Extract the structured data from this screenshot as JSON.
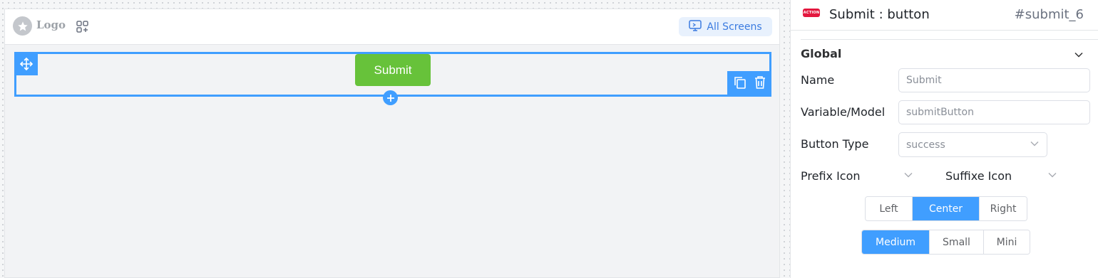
{
  "canvas": {
    "logo_text": "Logo",
    "screens_label": "All Screens",
    "submit_label": "Submit",
    "icons": [
      "star-icon",
      "add-widget-icon",
      "monitor-icon",
      "move-icon",
      "copy-icon",
      "delete-icon",
      "plus-icon"
    ]
  },
  "panel": {
    "badge_text": "ACTION",
    "title": "Submit : button",
    "component_id": "#submit_6",
    "section_title": "Global",
    "fields": {
      "name": {
        "label": "Name",
        "value": "Submit"
      },
      "variable": {
        "label": "Variable/Model",
        "value": "submitButton"
      },
      "button_type": {
        "label": "Button Type",
        "value": "success"
      },
      "prefix_icon": {
        "label": "Prefix Icon"
      },
      "suffix_icon": {
        "label": "Suffixe Icon"
      }
    },
    "alignment": {
      "options": [
        "Left",
        "Center",
        "Right"
      ],
      "selected": "Center"
    },
    "size": {
      "options": [
        "Medium",
        "Small",
        "Mini"
      ],
      "selected": "Medium"
    }
  },
  "colors": {
    "accent": "#409eff",
    "success": "#67c23a",
    "action_badge": "#e3173e"
  }
}
